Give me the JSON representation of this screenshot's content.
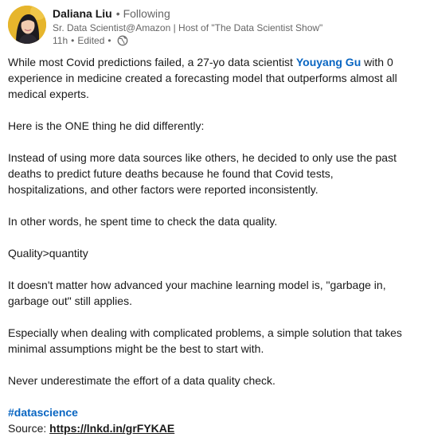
{
  "author": {
    "name": "Daliana Liu",
    "connection_separator": "•",
    "following_label": "Following",
    "headline": "Sr. Data Scientist@Amazon | Host of \"The Data Scientist Show\"",
    "time": "11h",
    "edited_label": "Edited",
    "meta_separator": "•",
    "visibility_icon": "globe-icon"
  },
  "post": {
    "p1_before": "While most Covid predictions failed, a 27-yo data scientist ",
    "p1_mention": "Youyang Gu",
    "p1_after": " with 0 experience in medicine created a forecasting model that outperforms almost all medical experts.",
    "p2": "Here is the ONE thing he did differently:",
    "p3": "Instead of using more data sources like others, he decided to only use the past deaths to predict future deaths because he found that Covid tests, hospitalizations, and other factors were reported inconsistently.",
    "p4": "In other words, he spent time to check the data quality.",
    "p5": "Quality>quantity",
    "p6": "It doesn't matter how advanced your machine learning model is, \"garbage in, garbage out\" still applies.",
    "p7": "Especially when dealing with complicated problems, a simple solution that takes minimal assumptions might be the best to start with.",
    "p8": "Never underestimate the effort of a data quality check.",
    "hashtag": "#datascience",
    "source_label": "Source: ",
    "source_link": "https://lnkd.in/grFYKAE"
  },
  "colors": {
    "link_blue": "#0a66c2",
    "text": "#191919",
    "muted": "#666666",
    "avatar_bg": "#e9b72a"
  }
}
